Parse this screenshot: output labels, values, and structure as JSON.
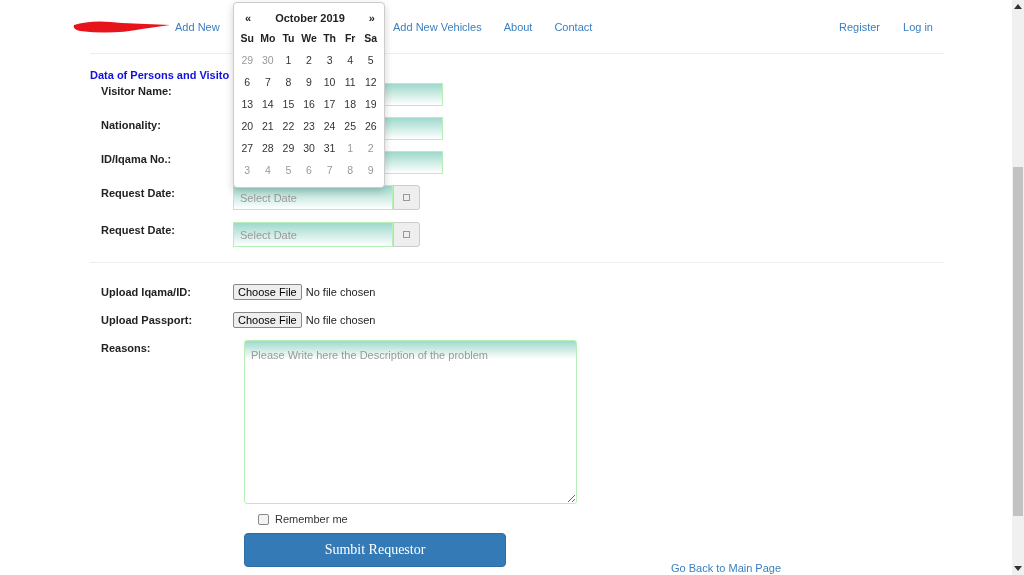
{
  "nav": {
    "left": [
      "Add New",
      "Add New Vehicles",
      "About",
      "Contact"
    ],
    "right": [
      "Register",
      "Log in"
    ]
  },
  "section_title": "Data of Persons and Visito",
  "fields": [
    {
      "label": "Visitor Name:",
      "kind": "text"
    },
    {
      "label": "Nationality:",
      "kind": "text"
    },
    {
      "label": "ID/Iqama No.:",
      "kind": "text"
    },
    {
      "label": "Request Date:",
      "kind": "date",
      "placeholder": "Select Date"
    },
    {
      "label": "Request Date:",
      "kind": "date",
      "placeholder": "Select Date"
    }
  ],
  "uploads": [
    {
      "label": "Upload Iqama/ID:",
      "button": "Choose File",
      "status": "No file chosen"
    },
    {
      "label": "Upload Passport:",
      "button": "Choose File",
      "status": "No file chosen"
    }
  ],
  "reasons": {
    "label": "Reasons:",
    "placeholder": "Please Write here the Description of the problem"
  },
  "remember": {
    "label": "Remember me",
    "checked": false
  },
  "submit": "Sumbit Requestor",
  "back_link": "Go Back to Main Page",
  "calendar": {
    "prev": "«",
    "title": "October 2019",
    "next": "»",
    "weekdays": [
      "Su",
      "Mo",
      "Tu",
      "We",
      "Th",
      "Fr",
      "Sa"
    ],
    "weeks": [
      [
        {
          "day": "29",
          "muted": true
        },
        {
          "day": "30",
          "muted": true
        },
        {
          "day": "1",
          "muted": false
        },
        {
          "day": "2",
          "muted": false
        },
        {
          "day": "3",
          "muted": false
        },
        {
          "day": "4",
          "muted": false
        },
        {
          "day": "5",
          "muted": false
        }
      ],
      [
        {
          "day": "6",
          "muted": false
        },
        {
          "day": "7",
          "muted": false
        },
        {
          "day": "8",
          "muted": false
        },
        {
          "day": "9",
          "muted": false
        },
        {
          "day": "10",
          "muted": false
        },
        {
          "day": "11",
          "muted": false
        },
        {
          "day": "12",
          "muted": false
        }
      ],
      [
        {
          "day": "13",
          "muted": false
        },
        {
          "day": "14",
          "muted": false
        },
        {
          "day": "15",
          "muted": false
        },
        {
          "day": "16",
          "muted": false
        },
        {
          "day": "17",
          "muted": false
        },
        {
          "day": "18",
          "muted": false
        },
        {
          "day": "19",
          "muted": false
        }
      ],
      [
        {
          "day": "20",
          "muted": false
        },
        {
          "day": "21",
          "muted": false
        },
        {
          "day": "22",
          "muted": false
        },
        {
          "day": "23",
          "muted": false
        },
        {
          "day": "24",
          "muted": false
        },
        {
          "day": "25",
          "muted": false
        },
        {
          "day": "26",
          "muted": false
        }
      ],
      [
        {
          "day": "27",
          "muted": false
        },
        {
          "day": "28",
          "muted": false
        },
        {
          "day": "29",
          "muted": false
        },
        {
          "day": "30",
          "muted": false
        },
        {
          "day": "31",
          "muted": false
        },
        {
          "day": "1",
          "muted": true
        },
        {
          "day": "2",
          "muted": true
        }
      ],
      [
        {
          "day": "3",
          "muted": true
        },
        {
          "day": "4",
          "muted": true
        },
        {
          "day": "5",
          "muted": true
        },
        {
          "day": "6",
          "muted": true
        },
        {
          "day": "7",
          "muted": true
        },
        {
          "day": "8",
          "muted": true
        },
        {
          "day": "9",
          "muted": true
        }
      ]
    ]
  }
}
